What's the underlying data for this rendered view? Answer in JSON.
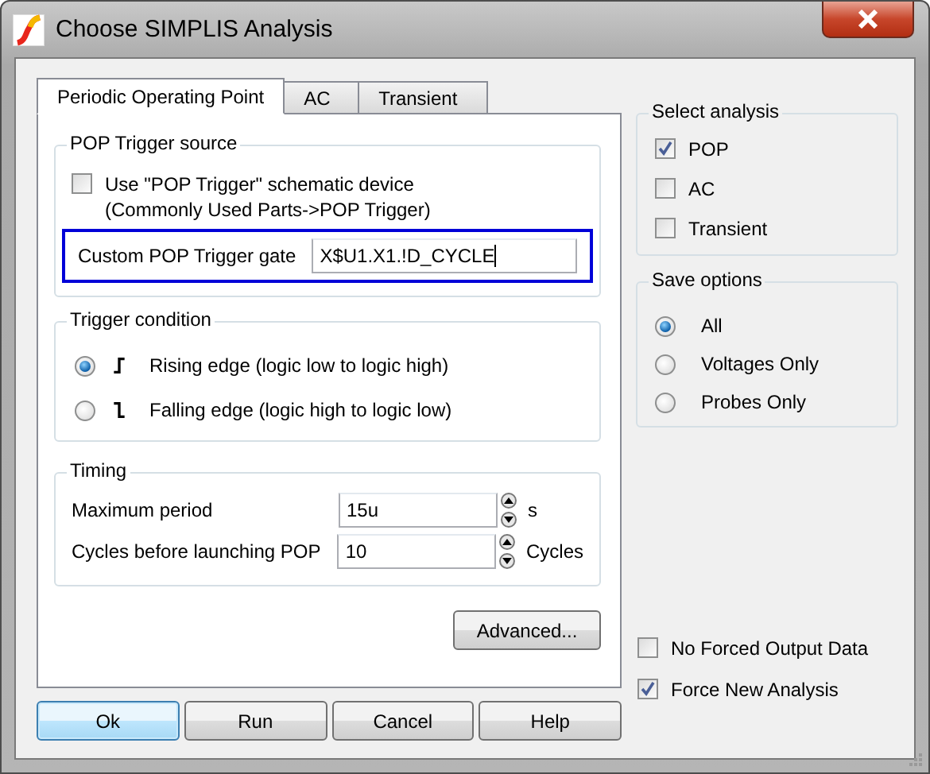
{
  "window": {
    "title": "Choose SIMPLIS Analysis"
  },
  "tabs": [
    {
      "label": "Periodic Operating Point",
      "selected": true
    },
    {
      "label": "AC",
      "selected": false
    },
    {
      "label": "Transient",
      "selected": false
    }
  ],
  "trigger_source": {
    "title": "POP Trigger source",
    "use_device": {
      "label": "Use \"POP Trigger\" schematic device\n(Commonly Used Parts->POP Trigger)",
      "checked": false
    },
    "custom_gate": {
      "label": "Custom POP Trigger gate",
      "value": "X$U1.X1.!D_CYCLE",
      "focused": true
    }
  },
  "trigger_condition": {
    "title": "Trigger condition",
    "options": [
      {
        "label": "Rising edge (logic low to logic high)",
        "kind": "rising",
        "selected": true
      },
      {
        "label": "Falling edge (logic high to logic low)",
        "kind": "falling",
        "selected": false
      }
    ]
  },
  "timing": {
    "title": "Timing",
    "fields": [
      {
        "label": "Maximum period",
        "value": "15u",
        "unit": "s"
      },
      {
        "label": "Cycles before launching POP",
        "value": "10",
        "unit": "Cycles"
      }
    ]
  },
  "advanced_button": "Advanced...",
  "select_analysis": {
    "title": "Select analysis",
    "items": [
      {
        "label": "POP",
        "checked": true
      },
      {
        "label": "AC",
        "checked": false
      },
      {
        "label": "Transient",
        "checked": false
      }
    ]
  },
  "save_options": {
    "title": "Save options",
    "options": [
      {
        "label": "All",
        "selected": true
      },
      {
        "label": "Voltages Only",
        "selected": false
      },
      {
        "label": "Probes Only",
        "selected": false
      }
    ]
  },
  "output_flags": [
    {
      "label": "No Forced Output Data",
      "checked": false
    },
    {
      "label": "Force New Analysis",
      "checked": true
    }
  ],
  "buttons": [
    {
      "label": "Ok",
      "default": true
    },
    {
      "label": "Run",
      "default": false
    },
    {
      "label": "Cancel",
      "default": false
    },
    {
      "label": "Help",
      "default": false
    }
  ]
}
